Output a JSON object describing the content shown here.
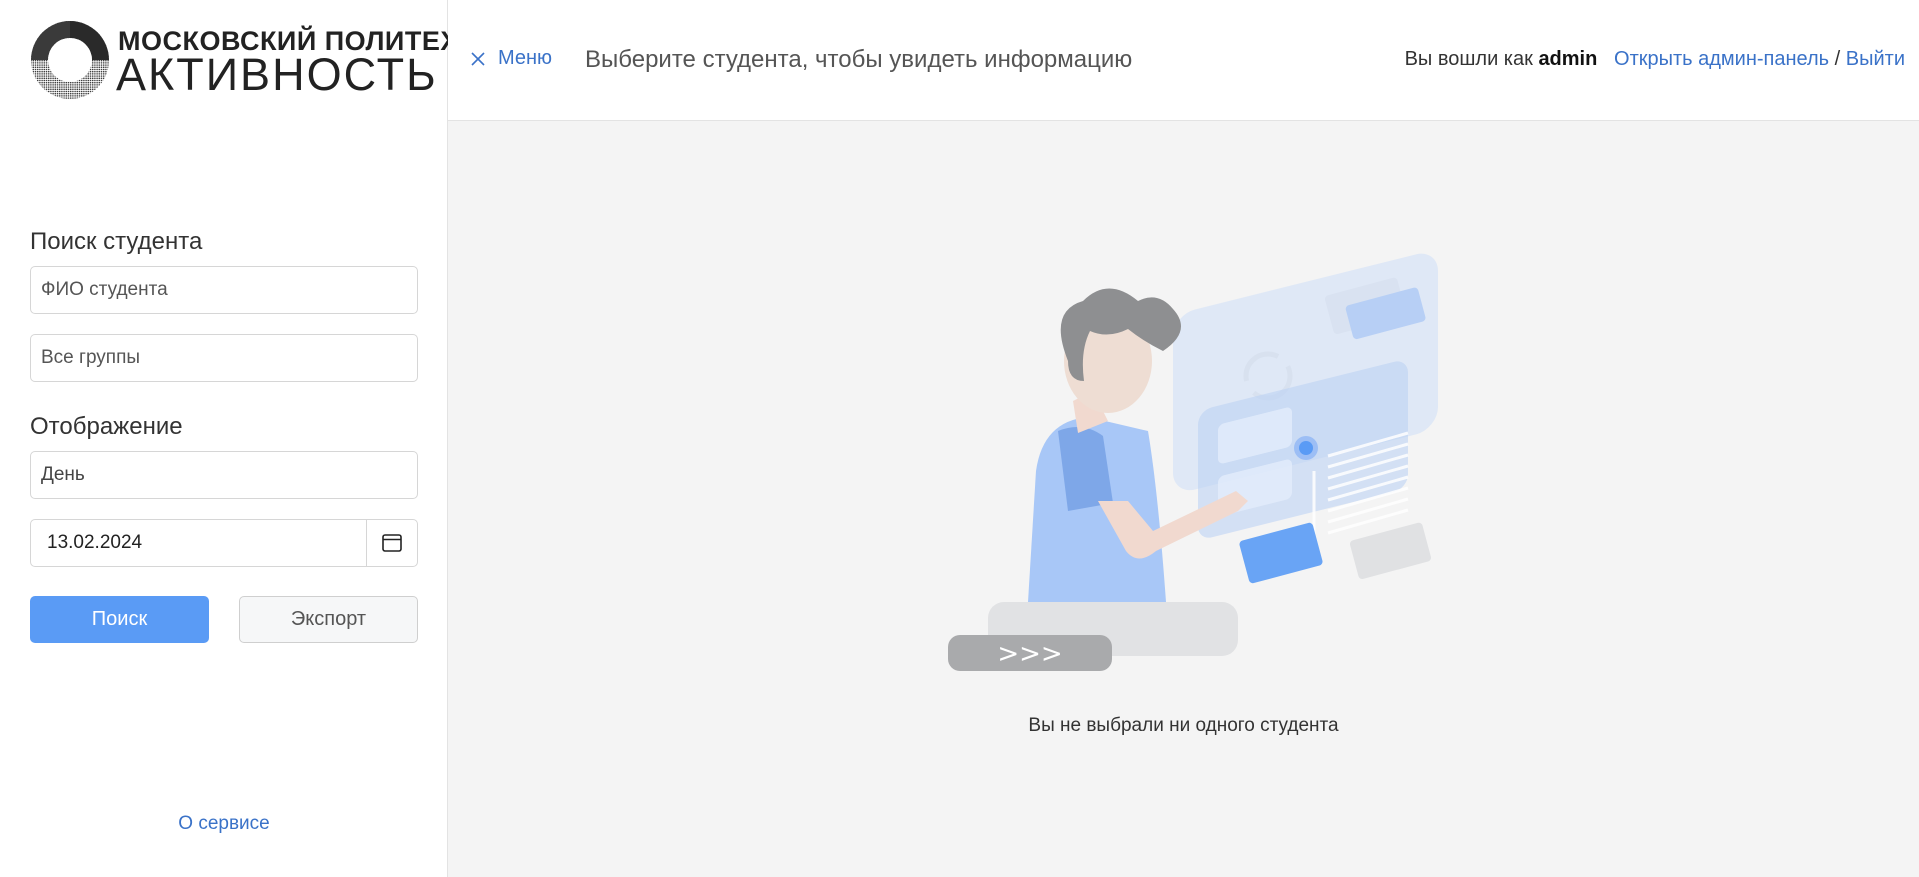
{
  "logo": {
    "line1": "МОСКОВСКИЙ ПОЛИТЕХ",
    "line2": "АКТИВНОСТЬ"
  },
  "sidebar": {
    "search_title": "Поиск студента",
    "student_field_placeholder": "ФИО студента",
    "group_field_placeholder": "Все группы",
    "display_title": "Отображение",
    "display_mode_value": "День",
    "date_value": "13.02.2024",
    "search_button": "Поиск",
    "export_button": "Экспорт",
    "about_link": "О сервисе"
  },
  "header": {
    "menu_label": "Меню",
    "title": "Выберите студента, чтобы увидеть информацию",
    "logged_in_prefix": "Вы вошли как",
    "username": "admin",
    "admin_link": "Открыть админ-панель",
    "separator": "/",
    "logout_link": "Выйти"
  },
  "main": {
    "empty_message": "Вы не выбрали ни одного студента"
  },
  "icons": {
    "close": "close-icon",
    "calendar": "calendar-icon"
  },
  "colors": {
    "accent": "#5a9bf5",
    "link": "#3a72c8",
    "background": "#f4f4f4"
  }
}
